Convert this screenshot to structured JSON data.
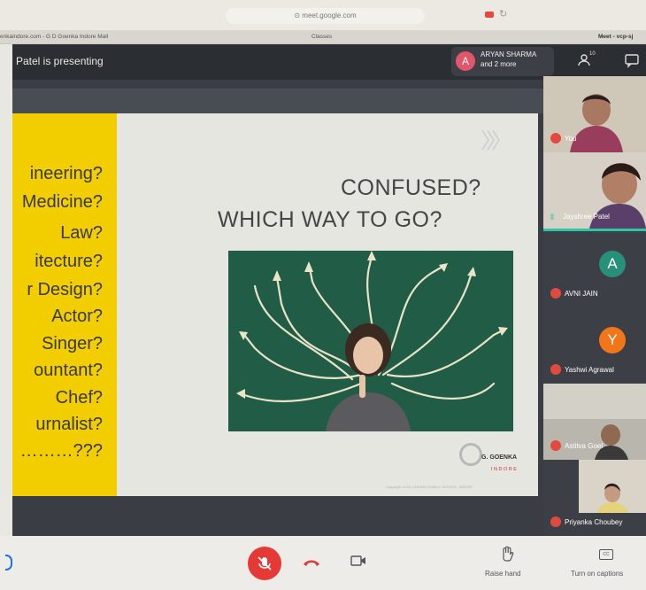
{
  "browser": {
    "url": "meet.google.com",
    "tabs": [
      "enkaindore.com - G D Goenka Indore Mall",
      "Classes",
      "Meet - vcp-sj"
    ]
  },
  "meet": {
    "presenting_text": "Patel is presenting",
    "presenter_initial": "A",
    "presenter_name": "ARYAN SHARMA",
    "presenter_more": "and 2 more",
    "people_count": "10"
  },
  "slide": {
    "professions": [
      "ineering?",
      "Medicine?",
      "Law?",
      "itecture?",
      "r Design?",
      "Actor?",
      "Singer?",
      "ountant?",
      "Chef?",
      "urnalist?",
      "………???"
    ],
    "title_line1": "CONFUSED?",
    "title_line2": "WHICH WAY TO GO?",
    "logo_text": "G. GOENKA",
    "logo_sub": "INDORE",
    "copyright": "Copyright of GD GOENKA PUBLIC SCHOOL, INDORE"
  },
  "participants": [
    {
      "name": "You",
      "type": "video"
    },
    {
      "name": "Jayshree Patel",
      "type": "video"
    },
    {
      "name": "AVNI JAIN",
      "type": "letter",
      "initial": "A",
      "color": "#27907a"
    },
    {
      "name": "Yashwi Agrawal",
      "type": "letter",
      "initial": "Y",
      "color": "#f2751a"
    },
    {
      "name": "Astitva Goel",
      "type": "video"
    },
    {
      "name": "Priyanka Choubey",
      "type": "video"
    }
  ],
  "controls": {
    "raise_hand": "Raise hand",
    "captions": "Turn on captions"
  },
  "colors": {
    "accent_red": "#e53935",
    "header": "#2b2e33"
  }
}
